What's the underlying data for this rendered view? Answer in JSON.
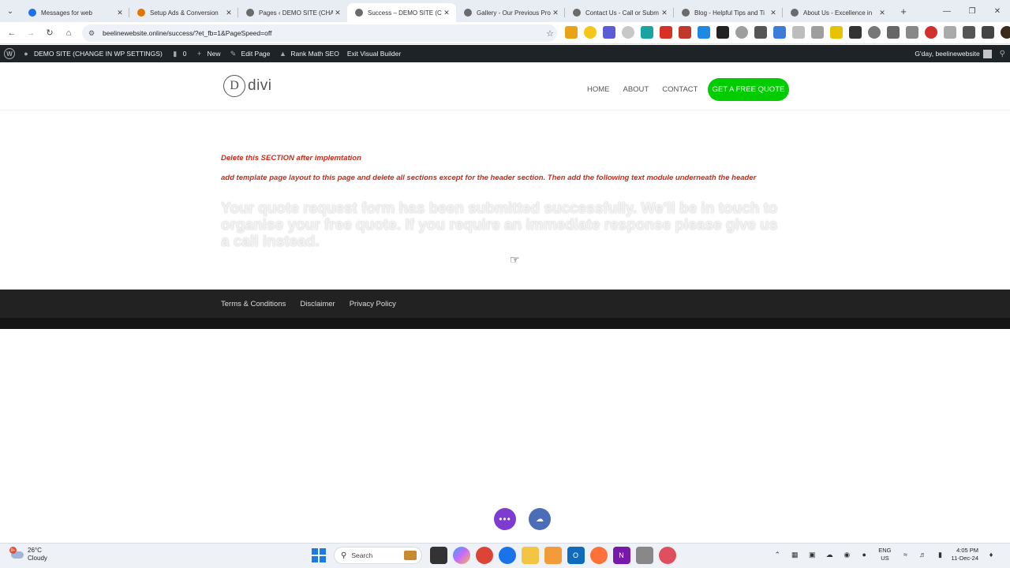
{
  "browser": {
    "tabs": [
      {
        "title": "Messages for web",
        "active": false
      },
      {
        "title": "Setup Ads & Conversion",
        "active": false
      },
      {
        "title": "Pages ‹ DEMO SITE (CHAN",
        "active": false
      },
      {
        "title": "Success – DEMO SITE (CH",
        "active": true
      },
      {
        "title": "Gallery - Our Previous Pro",
        "active": false
      },
      {
        "title": "Contact Us - Call or Subm",
        "active": false
      },
      {
        "title": "Blog - Helpful Tips and Ti",
        "active": false
      },
      {
        "title": "About Us - Excellence in",
        "active": false
      }
    ],
    "url": "beelinewebsite.online/success/?et_fb=1&PageSpeed=off"
  },
  "wp_admin_bar": {
    "site_name": "DEMO SITE (CHANGE IN WP SETTINGS)",
    "comments_count": "0",
    "new_label": "New",
    "edit_page_label": "Edit Page",
    "rank_math_label": "Rank Math SEO",
    "exit_builder_label": "Exit Visual Builder",
    "greeting": "G'day, beelinewebsite"
  },
  "site": {
    "logo_letter": "D",
    "logo_text": "divi",
    "nav": {
      "home": "HOME",
      "about": "ABOUT",
      "contact": "CONTACT",
      "cta": "GET A FREE QUOTE"
    },
    "cta_color": "#00cc00"
  },
  "content": {
    "note1": "Delete this SECTION after implemtation",
    "note2": "add template page layout to this page and delete all sections except for the header section. Then add the following text module underneath the header",
    "message": "Your quote request form has been submitted successfully. We'll be in touch to organise your free quote. If you require an immediate response please give us a call instead.",
    "note_color": "#cc2b1a"
  },
  "footer": {
    "links": [
      "Terms & Conditions",
      "Disclaimer",
      "Privacy Policy"
    ]
  },
  "taskbar": {
    "weather_temp": "26°C",
    "weather_desc": "Cloudy",
    "weather_badge": "9+",
    "search_placeholder": "Search",
    "lang_top": "ENG",
    "lang_bottom": "US",
    "time": "4:05 PM",
    "date": "11-Dec-24"
  }
}
